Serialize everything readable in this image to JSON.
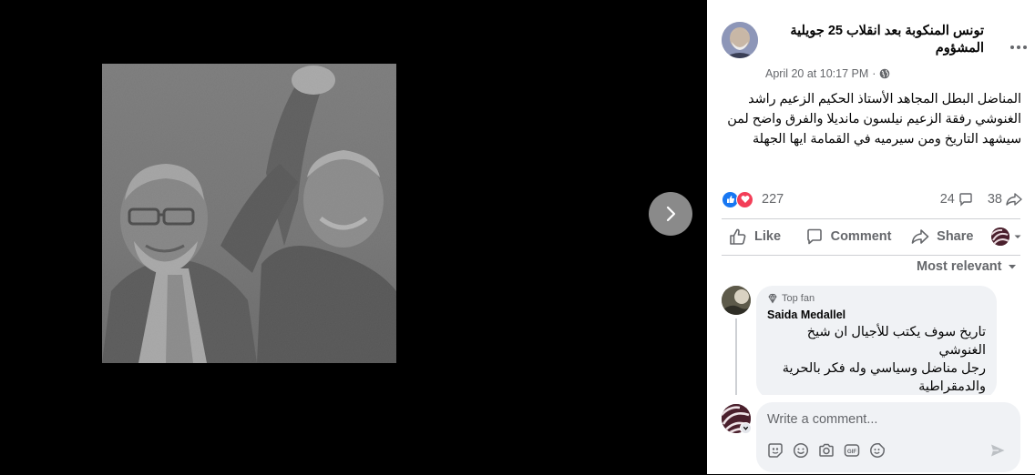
{
  "post": {
    "page_name": "تونس المنكوبة بعد انقلاب 25 جويلية المشؤوم",
    "timestamp": "April 20 at 10:17 PM",
    "separator": "·",
    "privacy_icon": "globe-icon",
    "text": "المناضل البطل المجاهد الأستاذ الحكيم الزعيم راشد الغنوشي رفقة الزعيم نيلسون مانديلا والفرق واضح لمن سيشهد التاريخ ومن سيرميه في القمامة ايها الجهلة"
  },
  "reactions": {
    "count": "227",
    "types": [
      "like-icon",
      "love-icon"
    ],
    "comments_count": "24",
    "shares_count": "38"
  },
  "actions": {
    "like_label": "Like",
    "comment_label": "Comment",
    "share_label": "Share"
  },
  "sort": {
    "label": "Most relevant"
  },
  "comments": [
    {
      "badge": "Top fan",
      "author": "Saida Medallel",
      "text_line1": "تاريخ سوف يكتب للأجيال ان شيخ الغنوشي",
      "text_line2": "رجل مناضل وسياسي وله فكر بالحرية والدمقراطية"
    }
  ],
  "composer": {
    "placeholder": "Write a comment...",
    "icons": [
      "avatar-sticker-icon",
      "emoji-icon",
      "camera-icon",
      "gif-icon",
      "sticker-icon"
    ],
    "send_icon": "send-icon"
  },
  "colors": {
    "accent": "#1877f2",
    "love": "#f33e58",
    "secondary_text": "#65676b",
    "bubble": "#f0f2f5"
  }
}
